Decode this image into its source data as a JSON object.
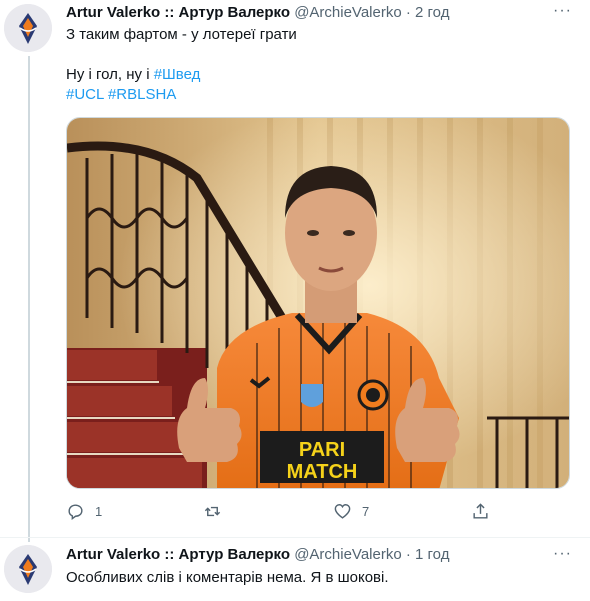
{
  "tweet1": {
    "display_name": "Artur Valerko :: Артур Валерко",
    "handle": "@ArchieValerko",
    "dot": "·",
    "time": "2 год",
    "more": "···",
    "line1": "З таким фартом - у лотереї грати",
    "line2_prefix": "Ну і гол, ну і ",
    "hashtag_shved": "#Швед",
    "hashtag_ucl": "#UCL",
    "hashtag_rblsha": "#RBLSHA",
    "media_jersey_sponsor": "PARIMATCH",
    "replies": "1",
    "retweets": "",
    "likes": "7"
  },
  "tweet2": {
    "display_name": "Artur Valerko :: Артур Валерко",
    "handle": "@ArchieValerko",
    "dot": "·",
    "time": "1 год",
    "more": "···",
    "line1": "Особливих слів і коментарів нема. Я в шокові."
  },
  "colors": {
    "link": "#1d9bf0",
    "secondary_text": "#536471",
    "jersey_orange": "#f07c1e",
    "thread_line": "#cfd9de"
  },
  "icons": {
    "reply": "reply-icon",
    "retweet": "retweet-icon",
    "like": "heart-icon",
    "share": "share-icon",
    "more": "more-icon"
  }
}
